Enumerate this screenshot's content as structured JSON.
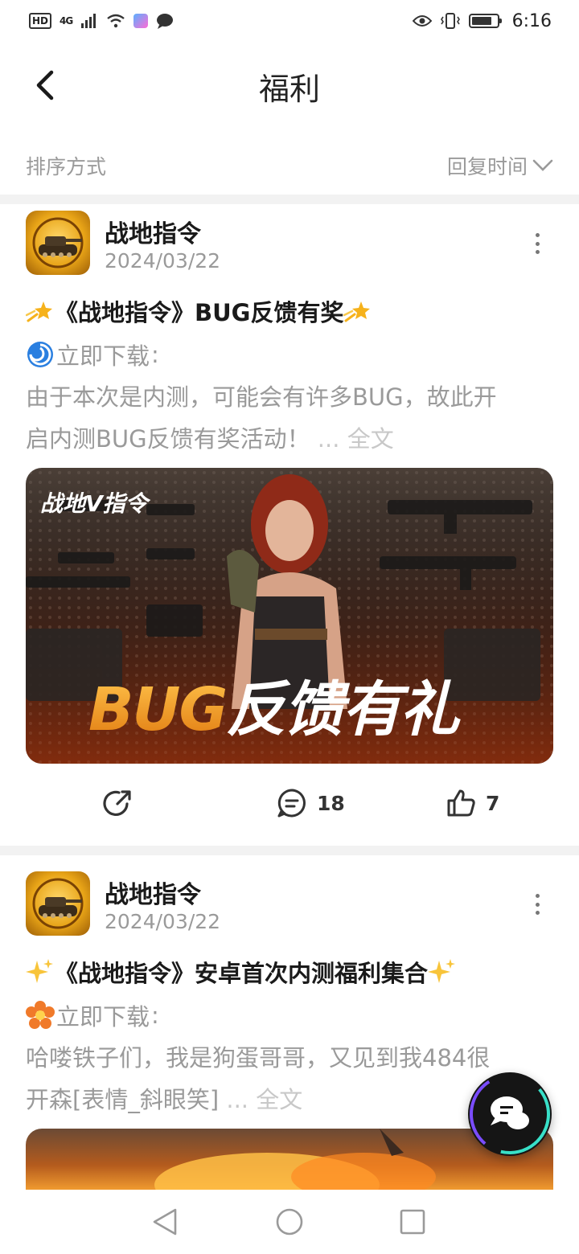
{
  "status_bar": {
    "hd": "HD",
    "network": "4G",
    "time": "6:16"
  },
  "header": {
    "title": "福利",
    "back_icon": "chevron-left-icon"
  },
  "sort": {
    "label": "排序方式",
    "value": "回复时间"
  },
  "posts": [
    {
      "author": "战地指令",
      "date": "2024/03/22",
      "title": "《战地指令》BUG反馈有奖",
      "title_icon": "shooting-star-icon",
      "download_label": "立即下载",
      "download_colon": ":",
      "download_icon": "swirl-icon",
      "body_line1": "由于本次是内测，可能会有许多BUG，故此开",
      "body_line2": "启内测BUG反馈有奖活动！",
      "ellipsis": " ... ",
      "fulltext": "全文",
      "banner": {
        "logo_text": "战地V指令",
        "headline_accent": "BUG",
        "headline_rest": "反馈有礼"
      },
      "comments": "18",
      "likes": "7"
    },
    {
      "author": "战地指令",
      "date": "2024/03/22",
      "title": "《战地指令》安卓首次内测福利集合",
      "title_icon": "sparkles-icon",
      "download_label": "立即下载",
      "download_colon": ":",
      "download_icon": "flower-icon",
      "body_line1": "哈喽铁子们，我是狗蛋哥哥，又见到我484很",
      "body_line2": "开森[表情_斜眼笑]",
      "ellipsis": " ... ",
      "fulltext": "全文"
    }
  ],
  "colors": {
    "accent_gold": "#e8a417",
    "muted_text": "#9a9a9a",
    "divider": "#f2f2f2"
  }
}
